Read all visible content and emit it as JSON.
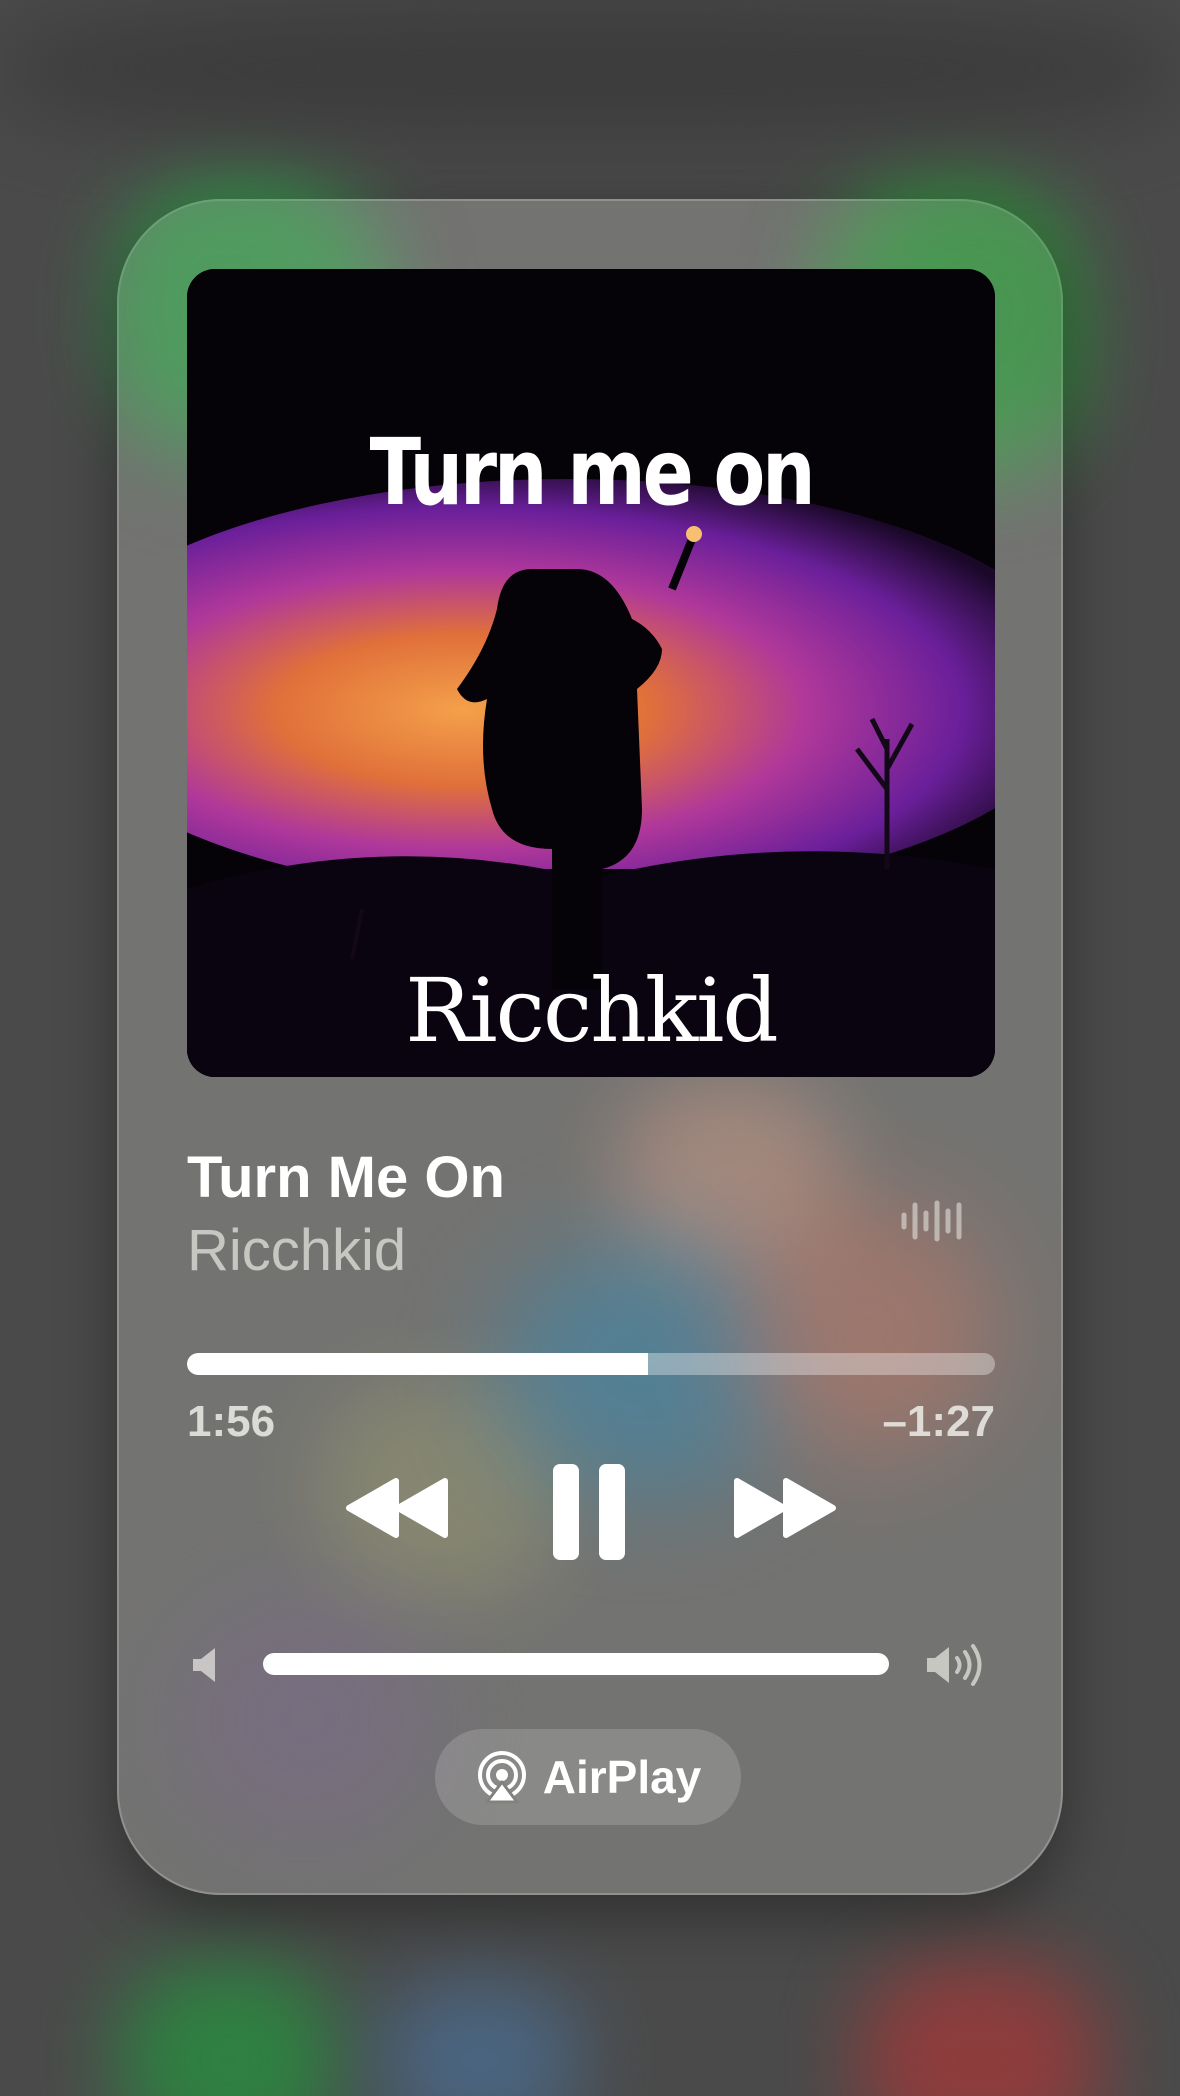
{
  "now_playing": {
    "song_title": "Turn Me On",
    "artist": "Ricchkid",
    "progress": 0.57,
    "time_elapsed": "1:56",
    "time_remaining": "–1:27",
    "volume": 1.0
  },
  "artwork": {
    "title_text": "Turn me on",
    "artist_text": "Ricchkid"
  },
  "controls": {
    "rewind_icon": "backward-icon",
    "pause_icon": "pause-icon",
    "forward_icon": "forward-icon"
  },
  "airplay": {
    "label": "AirPlay",
    "icon": "airplay-icon"
  },
  "colors": {
    "card": "#9a9a95",
    "art_purple": "#8a2fbf",
    "art_orange": "#f08a3a"
  }
}
